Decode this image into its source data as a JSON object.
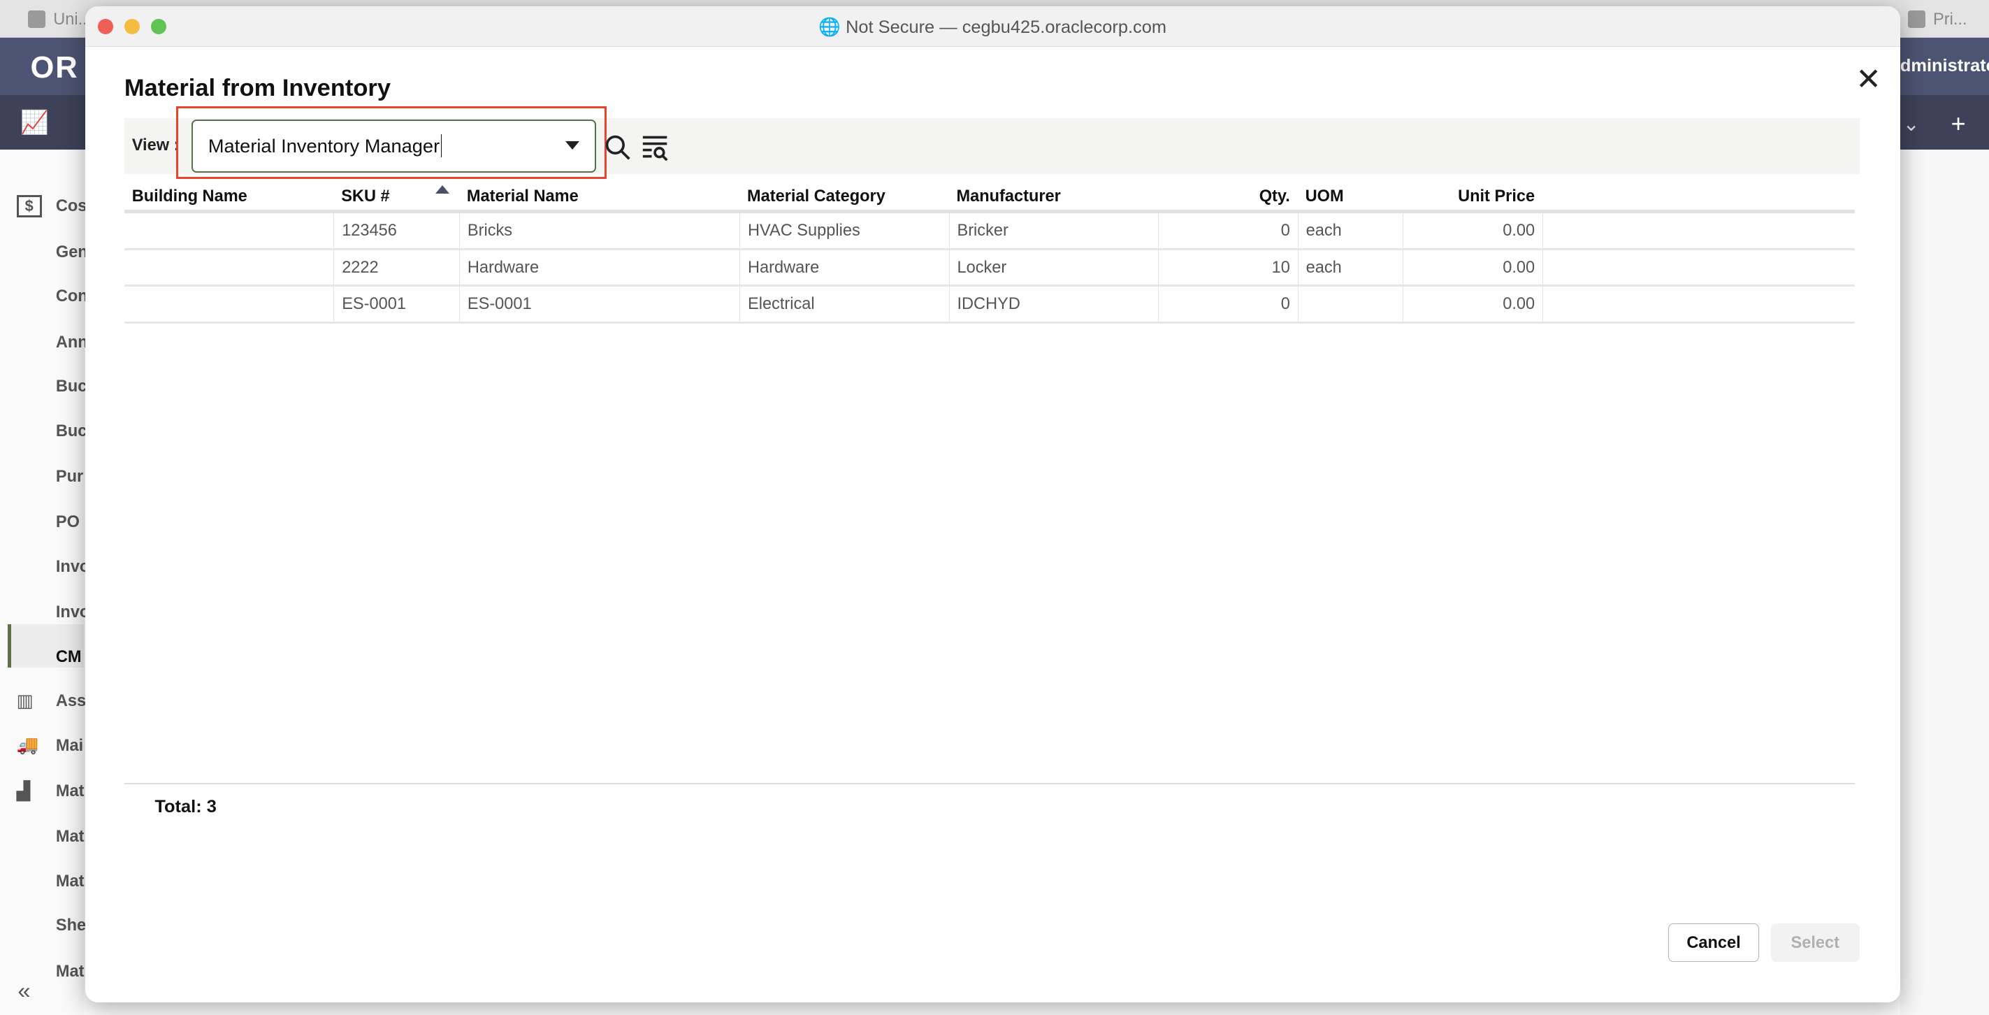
{
  "browser": {
    "tabs": [
      {
        "label": "Uni..."
      },
      {
        "label": "Pri..."
      }
    ],
    "url": "Not Secure — cegbu425.oraclecorp.com"
  },
  "app": {
    "logo": "OR",
    "user": "dministrato"
  },
  "sidebar": {
    "items": [
      {
        "label": "Cos",
        "icon": "dollar-icon"
      },
      {
        "label": "Gen"
      },
      {
        "label": "Con"
      },
      {
        "label": "Ann"
      },
      {
        "label": "Buc"
      },
      {
        "label": "Buc"
      },
      {
        "label": "Pur"
      },
      {
        "label": "PO"
      },
      {
        "label": "Invo"
      },
      {
        "label": "Invo"
      },
      {
        "label": "CM",
        "selected": true
      },
      {
        "label": "Ass",
        "icon": "barcode-icon"
      },
      {
        "label": "Mai",
        "icon": "truck-icon"
      },
      {
        "label": "Mat",
        "icon": "boxes-icon"
      },
      {
        "label": "Mat"
      },
      {
        "label": "Mat"
      },
      {
        "label": "She"
      },
      {
        "label": "Mat"
      }
    ],
    "collapse": "«"
  },
  "dialog": {
    "title": "Material from Inventory",
    "view_label": "View :",
    "view_value": "Material Inventory Manager",
    "columns": [
      "Building Name",
      "SKU #",
      "Material Name",
      "Material Category",
      "Manufacturer",
      "Qty.",
      "UOM",
      "Unit Price"
    ],
    "sort": {
      "column": "SKU #",
      "direction": "ascending"
    },
    "rows": [
      [
        "",
        "123456",
        "Bricks",
        "HVAC Supplies",
        "Bricker",
        "0",
        "each",
        "0.00"
      ],
      [
        "",
        "2222",
        "Hardware",
        "Hardware",
        "Locker",
        "10",
        "each",
        "0.00"
      ],
      [
        "",
        "ES-0001",
        "ES-0001",
        "Electrical",
        "IDCHYD",
        "0",
        "",
        "0.00"
      ]
    ],
    "total": "Total: 3",
    "cancel": "Cancel",
    "select": "Select"
  },
  "colors": {
    "highlight": "#e8452f",
    "accent": "#5a6e48",
    "header": "#4d5372"
  }
}
